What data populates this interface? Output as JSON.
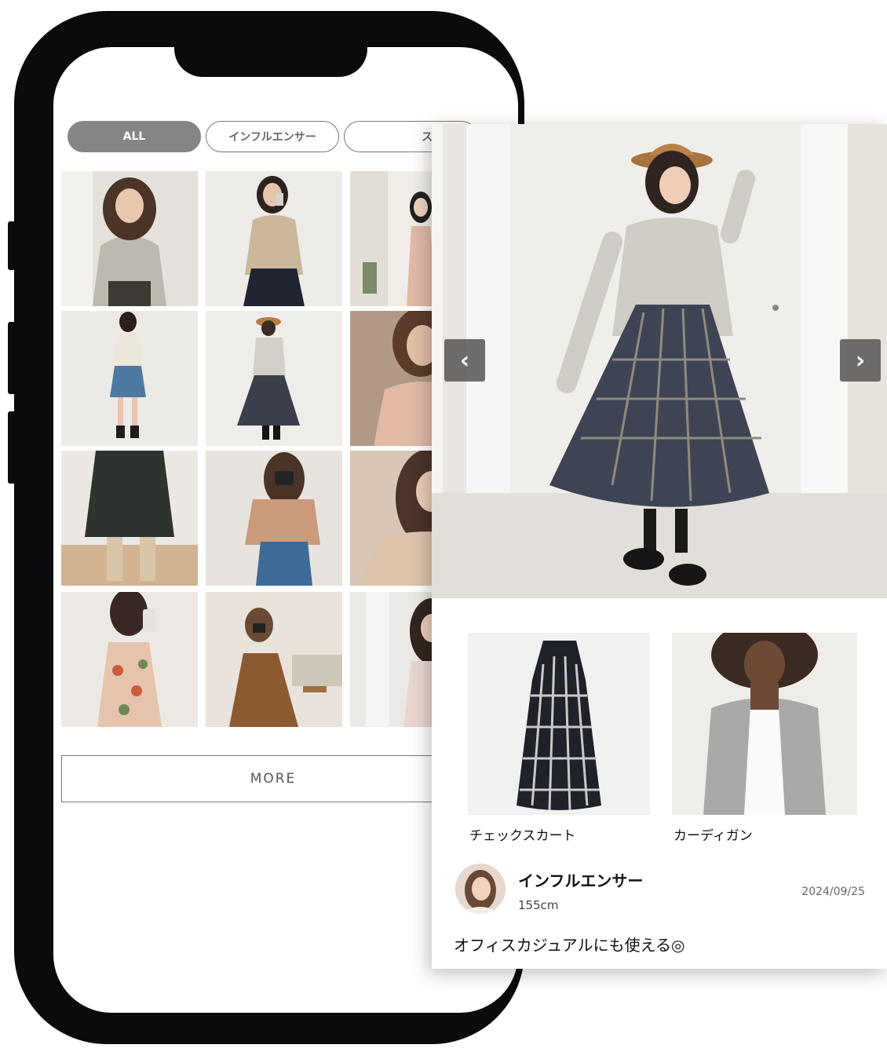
{
  "tabs": [
    {
      "label": "ALL",
      "active": true
    },
    {
      "label": "インフルエンサー",
      "active": false
    },
    {
      "label": "スタッフ",
      "active": false
    }
  ],
  "grid_photos": [
    {
      "icon": "woman-gray-sweater-photo"
    },
    {
      "icon": "woman-beige-top-mirror-selfie-photo"
    },
    {
      "icon": "woman-floral-dress-photo"
    },
    {
      "icon": "woman-denim-skirt-photo"
    },
    {
      "icon": "woman-plaid-skirt-photo"
    },
    {
      "icon": "woman-pink-knit-photo"
    },
    {
      "icon": "pleated-dark-skirt-photo"
    },
    {
      "icon": "woman-camera-denim-photo"
    },
    {
      "icon": "woman-selfie-long-hair-photo"
    },
    {
      "icon": "woman-floral-dress-selfie-photo"
    },
    {
      "icon": "woman-brown-outfit-sitting-photo"
    },
    {
      "icon": "woman-light-outfit-photo"
    }
  ],
  "more_label": "MORE",
  "detail": {
    "nav_prev": "‹",
    "nav_next": "›",
    "products": [
      {
        "name": "チェックスカート",
        "icon": "plaid-maxi-skirt-photo"
      },
      {
        "name": "カーディガン",
        "icon": "gray-cardigan-photo"
      }
    ],
    "user": {
      "name": "インフルエンサー",
      "height": "155cm"
    },
    "date": "2024/09/25",
    "caption": "オフィスカジュアルにも使える◎"
  }
}
